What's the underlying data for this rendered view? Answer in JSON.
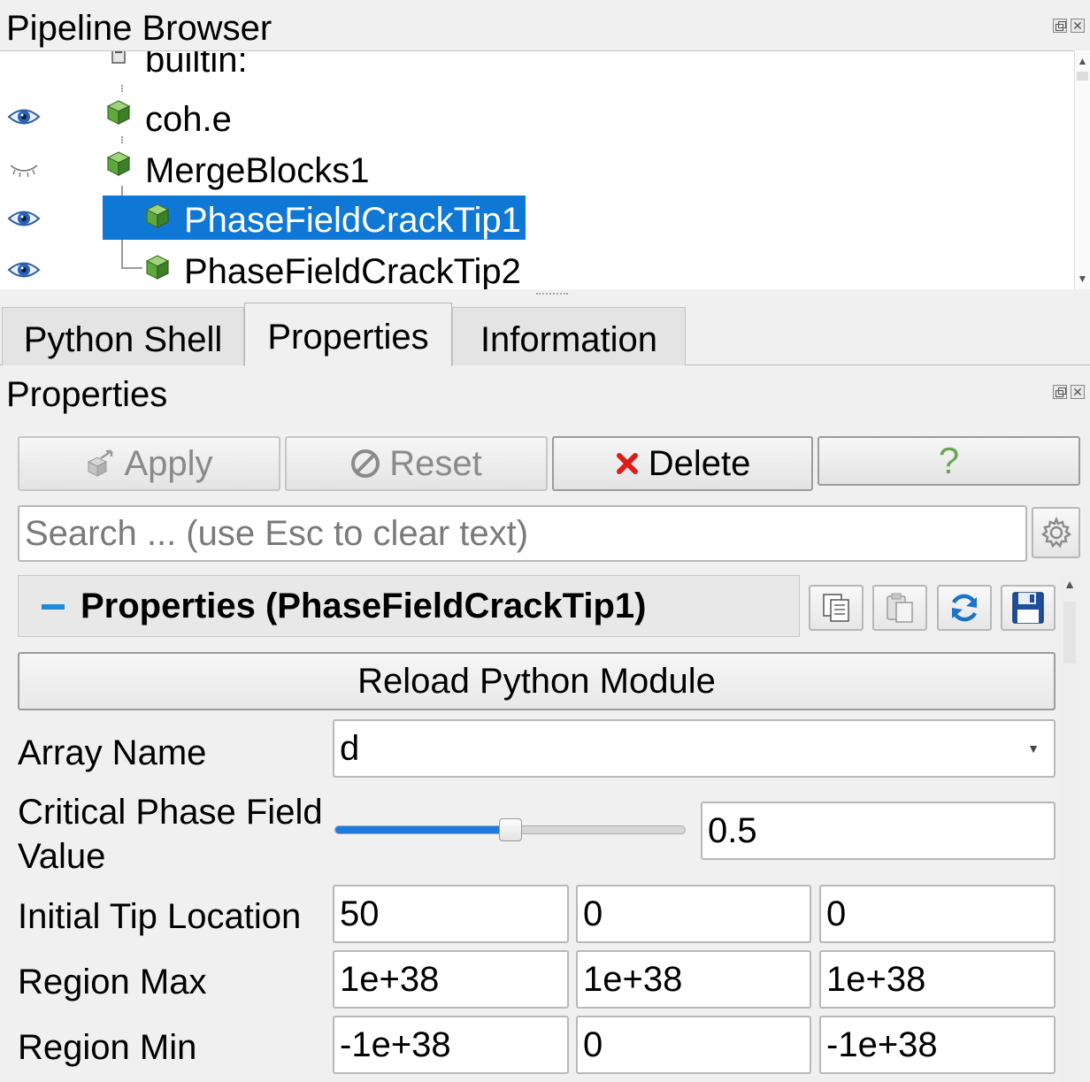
{
  "pipeline_browser": {
    "title": "Pipeline Browser",
    "items": [
      {
        "label": "builtin:",
        "visible": null
      },
      {
        "label": "coh.e",
        "visible": true
      },
      {
        "label": "MergeBlocks1",
        "visible": false
      },
      {
        "label": "PhaseFieldCrackTip1",
        "visible": true,
        "selected": true
      },
      {
        "label": "PhaseFieldCrackTip2",
        "visible": true
      }
    ],
    "icons": {
      "eye": "eye-icon",
      "eye_closed": "eye-closed-icon",
      "source": "cube-icon",
      "server": "server-icon"
    }
  },
  "tabs": [
    {
      "label": "Python Shell",
      "active": false
    },
    {
      "label": "Properties",
      "active": true
    },
    {
      "label": "Information",
      "active": false
    }
  ],
  "properties_panel": {
    "title": "Properties",
    "buttons": {
      "apply": "Apply",
      "reset": "Reset",
      "delete": "Delete",
      "help": "?"
    },
    "search": {
      "placeholder": "Search ... (use Esc to clear text)"
    },
    "section": {
      "toggle": "−",
      "title": "Properties (PhaseFieldCrackTip1)"
    },
    "reload_button": "Reload Python Module",
    "fields": {
      "array_name": {
        "label": "Array Name",
        "value": "d"
      },
      "critical_value": {
        "label_line1": "Critical Phase Field",
        "label_line2": "Value",
        "value": "0.5",
        "slider_fraction": 0.5
      },
      "initial_tip": {
        "label": "Initial Tip Location",
        "values": [
          "50",
          "0",
          "0"
        ]
      },
      "region_max": {
        "label": "Region Max",
        "values": [
          "1e+38",
          "1e+38",
          "1e+38"
        ]
      },
      "region_min": {
        "label": "Region Min",
        "values": [
          "-1e+38",
          "0",
          "-1e+38"
        ]
      }
    }
  },
  "colors": {
    "selection": "#0f78d7",
    "delete_red": "#e01b1b",
    "help_green": "#6aa84f",
    "slider_blue": "#1f7ae0"
  }
}
